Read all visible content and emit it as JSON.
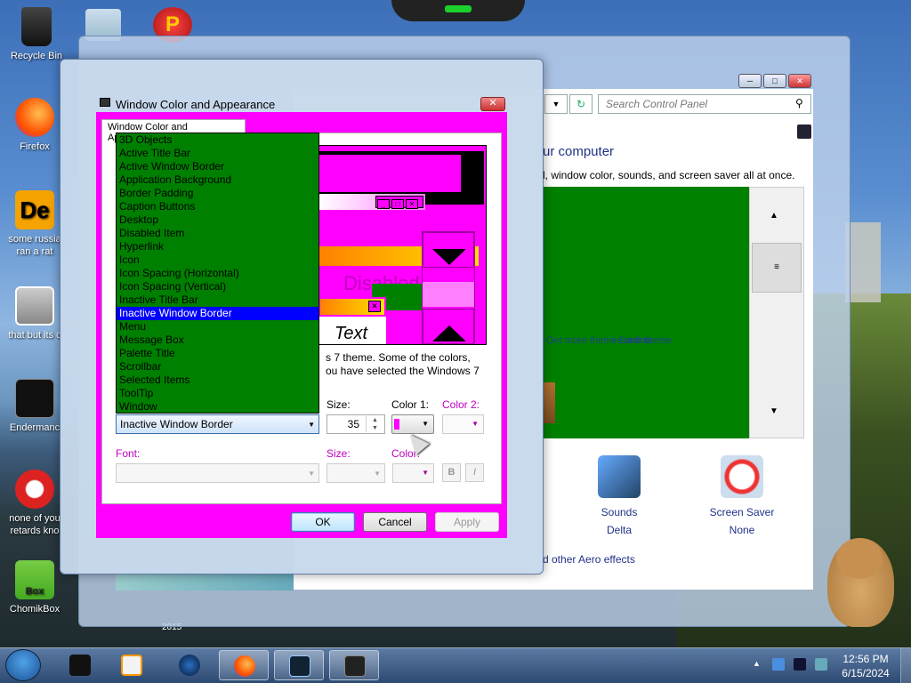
{
  "desktop": {
    "icons": [
      {
        "label": "Recycle Bin",
        "name": "recycle-bin"
      },
      {
        "label": "Firefox",
        "name": "firefox"
      },
      {
        "label": "some russia ran a rat",
        "name": "de-app"
      },
      {
        "label": "that but its c",
        "name": "copy-app"
      },
      {
        "label": "Endermanc",
        "name": "enderman"
      },
      {
        "label": "none of you retards kno",
        "name": "dragon-app"
      },
      {
        "label": "ChomikBox",
        "name": "chomikbox"
      }
    ],
    "partial_label": "2015"
  },
  "control_panel": {
    "search_placeholder": "Search Control Panel",
    "heading": "ur computer",
    "description": "l, window color, sounds, and screen saver all at once.",
    "links": [
      "Get more themes online",
      "Save theme"
    ],
    "items": [
      {
        "label": "Sounds",
        "value": "Delta"
      },
      {
        "label": "Screen Saver",
        "value": "None"
      }
    ],
    "aero_link": "d other Aero effects",
    "window_buttons": [
      "─",
      "□",
      "✕"
    ]
  },
  "dialog": {
    "title": "Window Color and Appearance",
    "tab": "Window Color and Appearance",
    "preview": {
      "inactive_text": "Disabled",
      "message_text": "Text",
      "ctrl_buttons": [
        "_",
        "□",
        "✕"
      ]
    },
    "item_options": [
      "3D Objects",
      "Active Title Bar",
      "Active Window Border",
      "Application Background",
      "Border Padding",
      "Caption Buttons",
      "Desktop",
      "Disabled Item",
      "Hyperlink",
      "Icon",
      "Icon Spacing (Horizontal)",
      "Icon Spacing (Vertical)",
      "Inactive Title Bar",
      "Inactive Window Border",
      "Menu",
      "Message Box",
      "Palette Title",
      "Scrollbar",
      "Selected Items",
      "ToolTip",
      "Window"
    ],
    "selected_index": 13,
    "description_line1": "s 7 theme.  Some of the colors,",
    "description_line2": "ou have selected the Windows 7",
    "item_value": "Inactive Window Border",
    "size_label": "Size:",
    "size_value": "35",
    "color1_label": "Color 1:",
    "color1_value": "#ff00ff",
    "color2_label": "Color 2:",
    "font_label": "Font:",
    "font_size_label": "Size:",
    "font_color_label": "Color:",
    "bold_label": "B",
    "italic_label": "I",
    "ok_label": "OK",
    "cancel_label": "Cancel",
    "apply_label": "Apply"
  },
  "taskbar": {
    "time": "12:56 PM",
    "date": "6/15/2024"
  },
  "colors": {
    "dialog_bg": "#ff00ff",
    "list_bg": "#008000",
    "list_selected": "#0000ff"
  }
}
